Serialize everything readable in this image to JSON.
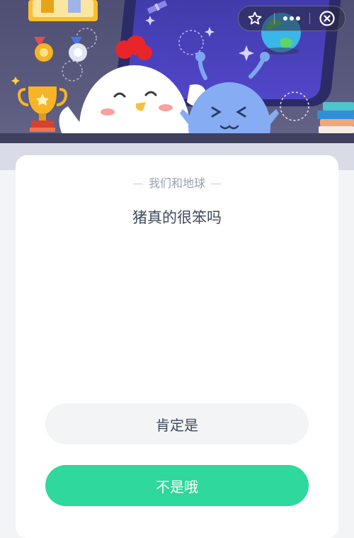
{
  "quiz": {
    "category_label": "我们和地球",
    "question": "猪真的很笨吗",
    "options": [
      {
        "label": "肯定是"
      },
      {
        "label": "不是哦"
      }
    ]
  },
  "capsule": {
    "favorite_icon": "star-outline-icon",
    "menu_icon": "more-dots-icon",
    "close_icon": "close-circle-icon"
  },
  "colors": {
    "accent": "#2fd89c",
    "banner_bg": "#56567a",
    "card_bg": "#ffffff",
    "question_text": "#3f4a5a"
  }
}
